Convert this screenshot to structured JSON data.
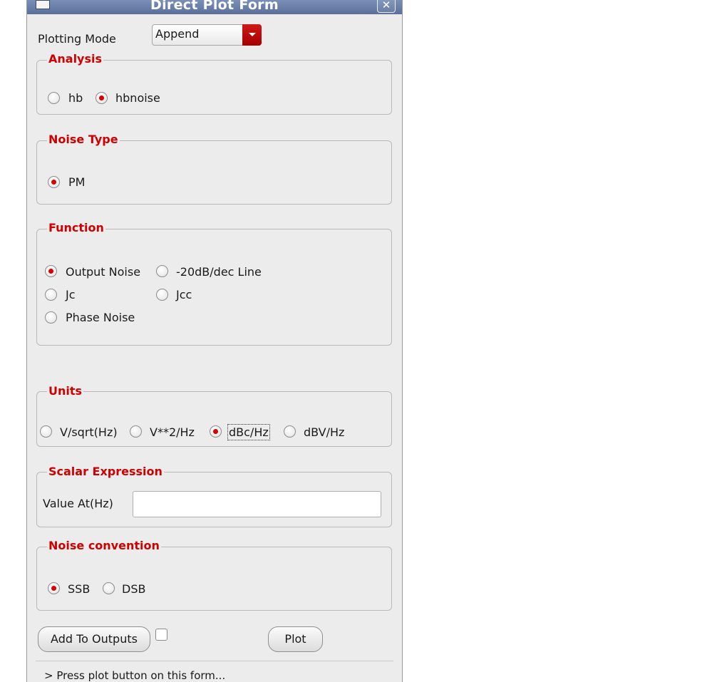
{
  "window": {
    "title": "Direct Plot Form",
    "close_glyph": "✕"
  },
  "plotting_mode": {
    "label": "Plotting Mode",
    "value": "Append"
  },
  "analysis": {
    "title": "Analysis",
    "options": [
      {
        "label": "hb",
        "checked": false
      },
      {
        "label": "hbnoise",
        "checked": true
      }
    ]
  },
  "noise_type": {
    "title": "Noise Type",
    "options": [
      {
        "label": "PM",
        "checked": true
      }
    ]
  },
  "function": {
    "title": "Function",
    "options": [
      {
        "label": "Output Noise",
        "checked": true
      },
      {
        "label": "-20dB/dec Line",
        "checked": false
      },
      {
        "label": "Jc",
        "checked": false
      },
      {
        "label": "Jcc",
        "checked": false
      },
      {
        "label": "Phase Noise",
        "checked": false
      }
    ]
  },
  "units": {
    "title": "Units",
    "options": [
      {
        "label": "V/sqrt(Hz)",
        "checked": false
      },
      {
        "label": "V**2/Hz",
        "checked": false
      },
      {
        "label": "dBc/Hz",
        "checked": true
      },
      {
        "label": "dBV/Hz",
        "checked": false
      }
    ]
  },
  "scalar_expression": {
    "title": "Scalar Expression",
    "label": "Value At(Hz)",
    "value": ""
  },
  "noise_convention": {
    "title": "Noise convention",
    "options": [
      {
        "label": "SSB",
        "checked": true
      },
      {
        "label": "DSB",
        "checked": false
      }
    ]
  },
  "buttons": {
    "add_to_outputs": "Add To Outputs",
    "plot": "Plot"
  },
  "add_to_outputs_checked": false,
  "status": "> Press plot button on this form..."
}
